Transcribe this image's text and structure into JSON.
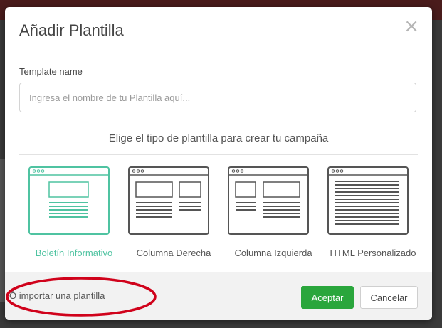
{
  "dialog": {
    "title": "Añadir Plantilla",
    "close_symbol": "×",
    "field_label": "Template name",
    "name_placeholder": "Ingresa el nombre de tu Plantilla aquí...",
    "subtitle": "Elige el tipo de plantilla para crear tu campaña",
    "templates": [
      {
        "label": "Boletín Informativo",
        "icon": "newsletter-layout-icon",
        "selected": true
      },
      {
        "label": "Columna Derecha",
        "icon": "right-column-layout-icon",
        "selected": false
      },
      {
        "label": "Columna Izquierda",
        "icon": "left-column-layout-icon",
        "selected": false
      },
      {
        "label": "HTML Personalizado",
        "icon": "custom-html-layout-icon",
        "selected": false
      }
    ]
  },
  "footer": {
    "import_link": "Ó importar una plantilla",
    "accept_label": "Aceptar",
    "cancel_label": "Cancelar"
  },
  "colors": {
    "accent": "#4fc3a1",
    "primary_button": "#2aa63c",
    "annotation": "#d0021b",
    "tile_stroke": "#555555"
  }
}
